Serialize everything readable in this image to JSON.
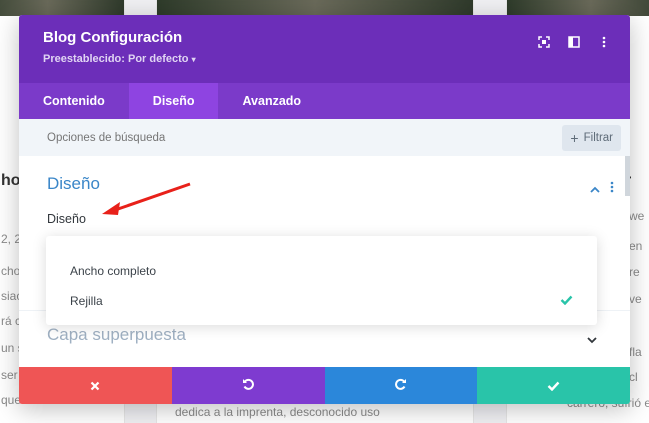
{
  "background": {
    "col1_lines": [
      "ho",
      "2, 2",
      "cho",
      "siac",
      "rá c",
      "un s",
      "ser",
      "que tiene una"
    ],
    "col2_line": "dedica a la imprenta, desconocido uso",
    "col2_line2": "...",
    "col3_lines": [
      "r",
      "we",
      "en",
      "re",
      "ve",
      "fla",
      "cl",
      "carrero, sufrió en"
    ]
  },
  "modal": {
    "title": "Blog Configuración",
    "preset": "Preestablecido: Por defecto",
    "preset_caret": "▾",
    "icons": {
      "focus": "focus-icon",
      "columns": "columns-icon",
      "more": "more-icon"
    }
  },
  "tabs": [
    {
      "label": "Contenido"
    },
    {
      "label": "Diseño"
    },
    {
      "label": "Avanzado"
    }
  ],
  "search": {
    "placeholder": "Opciones de búsqueda",
    "filter_label": "Filtrar",
    "filter_plus": "+"
  },
  "section": {
    "title": "Diseño",
    "field_label": "Diseño",
    "options": [
      {
        "label": "Ancho completo",
        "selected": false
      },
      {
        "label": "Rejilla",
        "selected": true
      }
    ]
  },
  "section2": {
    "title": "Capa superpuesta"
  },
  "footer": {
    "cancel": "close-icon",
    "undo": "undo-icon",
    "redo": "redo-icon",
    "save": "check-icon"
  },
  "colors": {
    "header": "#6c2eb9",
    "tabs": "#7b3ac9",
    "active_tab": "#8e44e1",
    "section_title": "#3a86c8",
    "check": "#29c4a9",
    "cancel": "#ef5555",
    "undo": "#7e3bd0",
    "redo": "#2b87da",
    "save": "#29c4a9",
    "arrow": "#e8211a"
  }
}
